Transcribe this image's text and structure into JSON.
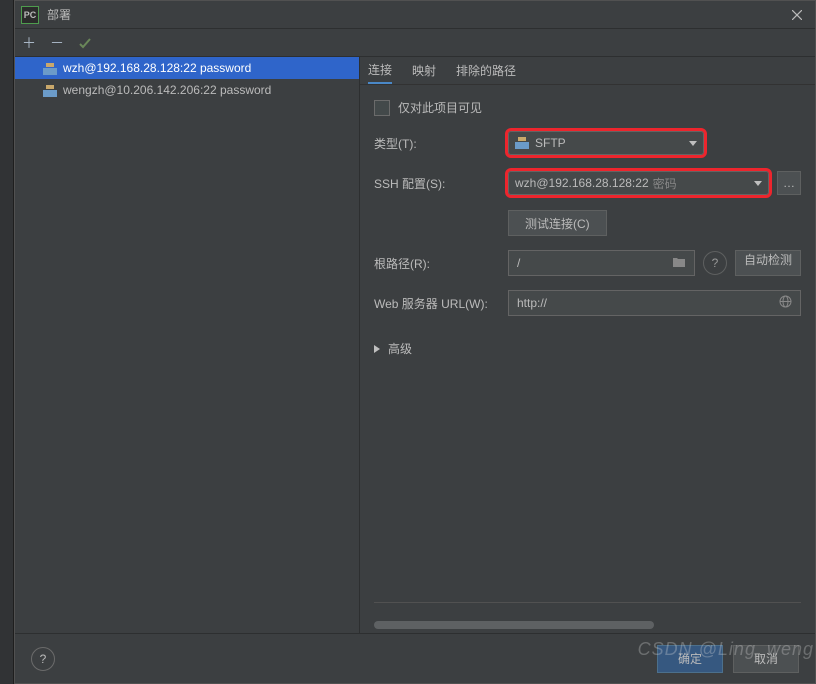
{
  "title": "部署",
  "servers": [
    {
      "label": "wzh@192.168.28.128:22 password",
      "selected": true
    },
    {
      "label": "wengzh@10.206.142.206:22 password",
      "selected": false
    }
  ],
  "tabs": {
    "connection": "连接",
    "mapping": "映射",
    "excluded": "排除的路径"
  },
  "form": {
    "visible_only_label": "仅对此项目可见",
    "type_label": "类型(T):",
    "type_value": "SFTP",
    "ssh_label": "SSH 配置(S):",
    "ssh_value": "wzh@192.168.28.128:22",
    "ssh_suffix": "密码",
    "test_connection": "测试连接(C)",
    "root_label": "根路径(R):",
    "root_value": "/",
    "auto_detect": "自动检测",
    "web_url_label": "Web 服务器 URL(W):",
    "web_url_value": "http://",
    "advanced": "高级"
  },
  "buttons": {
    "ok": "确定",
    "cancel": "取消"
  },
  "watermark": "CSDN @Ling_weng"
}
